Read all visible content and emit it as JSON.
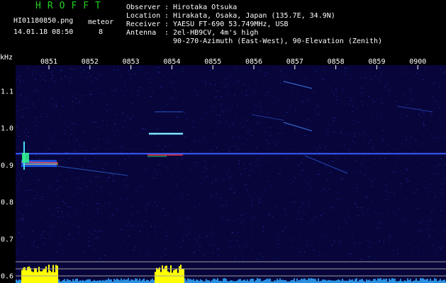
{
  "header": {
    "app_title": "HROFFT",
    "filename": "HI01180850.png",
    "datetime": "14.01.18 08:50",
    "meteor_label": "meteor",
    "meteor_count": "8",
    "observer_label": "Observer",
    "observer": "Hirotaka Otsuka",
    "location_label": "Location",
    "location": "Hirakata, Osaka, Japan (135.7E, 34.9N)",
    "receiver_label": "Receiver",
    "receiver": "YAESU FT-690 53.749MHz, USB",
    "antenna_label": "Antenna",
    "antenna_line1": "2el-HB9CV, 4m's high",
    "antenna_line2": "90-270-Azimuth (East-West), 90-Elevation (Zenith)"
  },
  "chart_data": {
    "type": "heatmap",
    "ylabel": "kHz",
    "x_ticks": [
      "0851",
      "0852",
      "0853",
      "0854",
      "0855",
      "0856",
      "0857",
      "0858",
      "0859",
      "0900"
    ],
    "y_ticks": [
      "1.1",
      "1.0",
      "0.9",
      "0.8",
      "0.7",
      "0.6"
    ],
    "carrier_khz": 0.93,
    "ylim": [
      0.58,
      1.17
    ],
    "colors": {
      "background": "#07053a",
      "carrier": "#3a5cff",
      "echo": "#40e0ff",
      "activity": "#ffff00",
      "noise": "#2a8fe0"
    }
  }
}
